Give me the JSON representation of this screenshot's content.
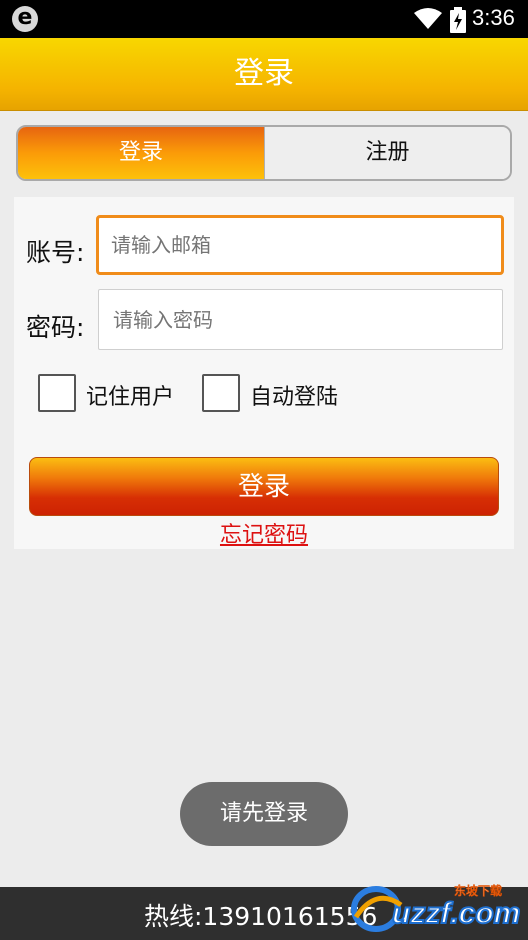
{
  "status_bar": {
    "app_icon_letter": "e",
    "time": "3:36"
  },
  "titlebar": {
    "title": "登录"
  },
  "tabs": [
    {
      "label": "登录",
      "active": true
    },
    {
      "label": "注册",
      "active": false
    }
  ],
  "form": {
    "account_label": "账号:",
    "account_placeholder": "请输入邮箱",
    "password_label": "密码:",
    "password_placeholder": "请输入密码",
    "remember_label": "记住用户",
    "auto_login_label": "自动登陆",
    "login_button": "登录",
    "forgot_link": "忘记密码"
  },
  "toast": {
    "text": "请先登录"
  },
  "footer": {
    "hotline": "热线:13910161556"
  },
  "watermark": {
    "text": "uzzf.com",
    "subtext": "东坡下载"
  },
  "colors": {
    "accent": "#f5b400",
    "button_red": "#d72f04",
    "link_red": "#dd1111"
  }
}
